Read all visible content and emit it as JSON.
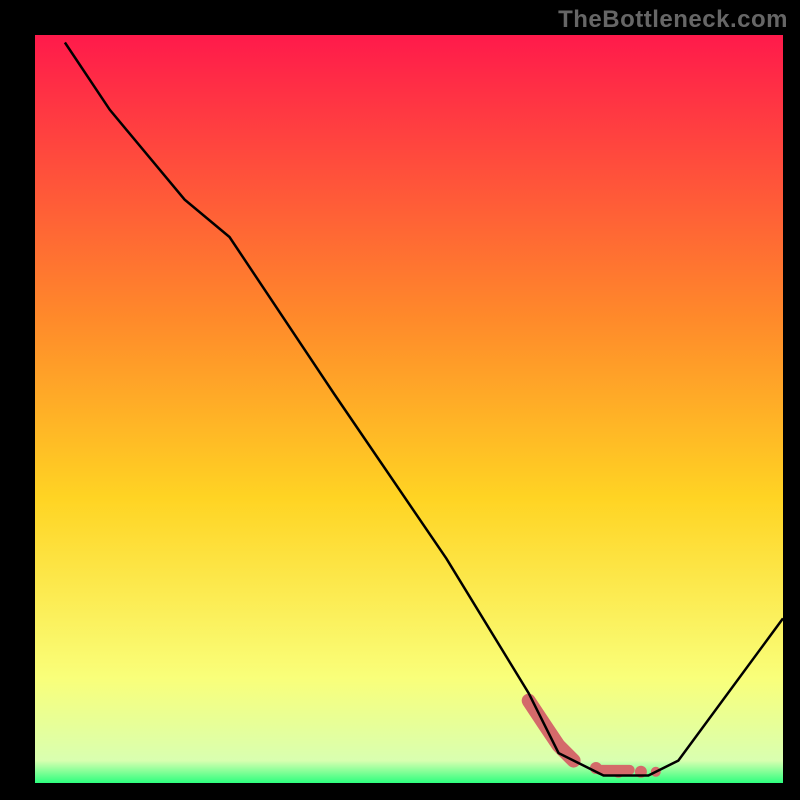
{
  "watermark": "TheBottleneck.com",
  "colors": {
    "frame": "#000000",
    "grad_top": "#ff1a4b",
    "grad_mid1": "#ff8a2a",
    "grad_mid2": "#ffd423",
    "grad_low": "#f9ff7a",
    "grad_base": "#2dff7e",
    "line": "#000000",
    "dots": "#d46a6a"
  },
  "chart_data": {
    "type": "line",
    "title": "",
    "xlabel": "",
    "ylabel": "",
    "xlim": [
      0,
      100
    ],
    "ylim": [
      0,
      100
    ],
    "series": [
      {
        "name": "black-curve",
        "x": [
          4,
          10,
          20,
          26,
          40,
          55,
          66,
          70,
          76,
          82,
          86,
          100
        ],
        "y": [
          99,
          90,
          78,
          73,
          52,
          30,
          12,
          4,
          1,
          1,
          3,
          22
        ]
      }
    ],
    "dots": {
      "name": "highlight-dots",
      "x": [
        66,
        68,
        70,
        72,
        75,
        78,
        81,
        83
      ],
      "y": [
        11,
        8,
        5,
        3,
        2,
        1.5,
        1.5,
        1.5
      ]
    },
    "gradient_stops": [
      {
        "offset": 0.0,
        "color": "#ff1a4b"
      },
      {
        "offset": 0.38,
        "color": "#ff8a2a"
      },
      {
        "offset": 0.62,
        "color": "#ffd423"
      },
      {
        "offset": 0.86,
        "color": "#f9ff7a"
      },
      {
        "offset": 0.97,
        "color": "#d9ffb0"
      },
      {
        "offset": 1.0,
        "color": "#2dff7e"
      }
    ]
  }
}
